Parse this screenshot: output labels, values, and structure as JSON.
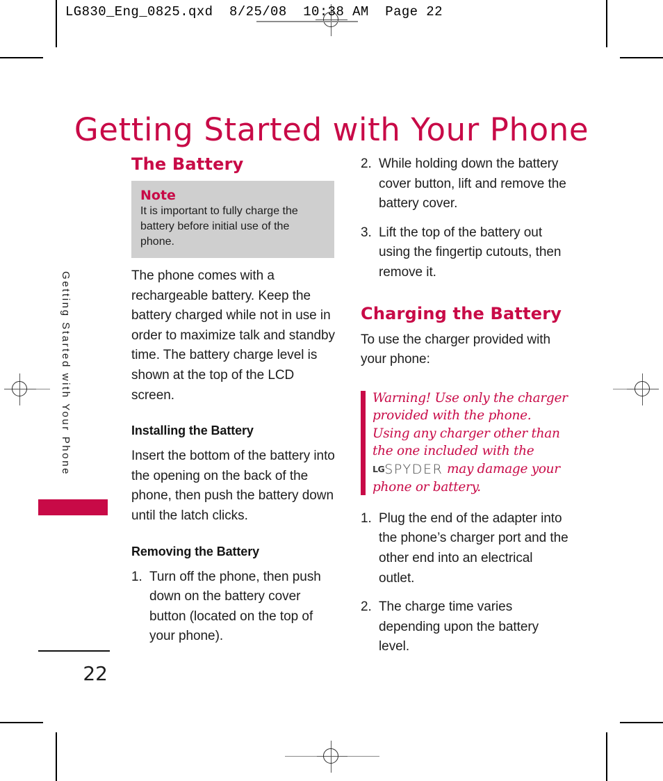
{
  "slug": {
    "text": "LG830_Eng_0825.qxd  8/25/08  10:38 AM  Page 22"
  },
  "chapter": {
    "title": "Getting Started with Your Phone",
    "side_tab_text": "Getting Started with Your Phone",
    "accent_color": "#C80A47"
  },
  "folio": {
    "page_number": "22"
  },
  "left_column": {
    "section_heading": "The Battery",
    "note": {
      "label": "Note",
      "text": "It is important to fully charge the battery before initial use of the phone."
    },
    "intro_paragraph": "The phone comes with a rechargeable battery. Keep the battery charged while not in use in order to maximize talk and standby time. The battery charge level is shown at the top of the LCD screen.",
    "installing": {
      "heading": "Installing the Battery",
      "paragraph": "Insert the bottom of the battery into the opening on the back of the phone, then push the battery down until the latch clicks."
    },
    "removing": {
      "heading": "Removing the Battery",
      "steps": [
        {
          "num": "1.",
          "text": "Turn off the phone, then push down on the battery cover button (located on the top of your phone)."
        }
      ]
    }
  },
  "right_column": {
    "removing_steps_continued": [
      {
        "num": "2.",
        "text": "While holding down the battery cover button, lift and remove the battery cover."
      },
      {
        "num": "3.",
        "text": "Lift the top of the battery out using the fingertip cutouts, then remove it."
      }
    ],
    "charging": {
      "heading": "Charging the Battery",
      "paragraph": "To use the charger provided with your phone:",
      "warning": {
        "text_before_logo": "Warning! Use only the charger provided with the phone. Using any charger other than the one included with the ",
        "logo_lg": "LG",
        "logo_model": "SPYDER",
        "text_after_logo": " may damage your phone or battery."
      },
      "steps": [
        {
          "num": "1.",
          "text": "Plug the end of the adapter into the phone’s charger port and the other end into an electrical outlet."
        },
        {
          "num": "2.",
          "text": "The charge time varies depending upon the battery level."
        }
      ]
    }
  }
}
